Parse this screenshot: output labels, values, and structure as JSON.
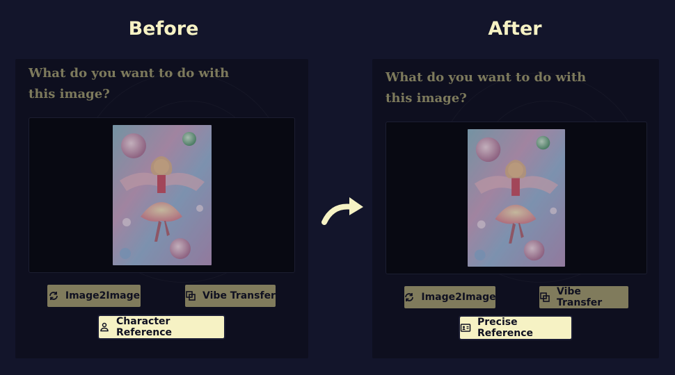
{
  "labels": {
    "before": "Before",
    "after": "After"
  },
  "before_panel": {
    "prompt": "What do you want to do with this image?",
    "buttons": {
      "image2image": "Image2Image",
      "vibe_transfer": "Vibe Transfer",
      "character_reference": "Character Reference"
    },
    "selected": "character_reference"
  },
  "after_panel": {
    "prompt": "What do you want to do with this image?",
    "buttons": {
      "image2image": "Image2Image",
      "vibe_transfer": "Vibe Transfer",
      "precise_reference": "Precise Reference"
    },
    "selected": "precise_reference"
  },
  "icons": {
    "image2image": "refresh-cycle-icon",
    "vibe_transfer": "overlapping-squares-icon",
    "character_reference": "person-icon",
    "precise_reference": "id-card-icon",
    "transition": "curved-arrow-icon"
  },
  "colors": {
    "background": "#13152b",
    "panel": "#0e0f1f",
    "heading": "#f6f2c4",
    "button": "#807b5c",
    "button_selected": "#f6f2c4"
  }
}
